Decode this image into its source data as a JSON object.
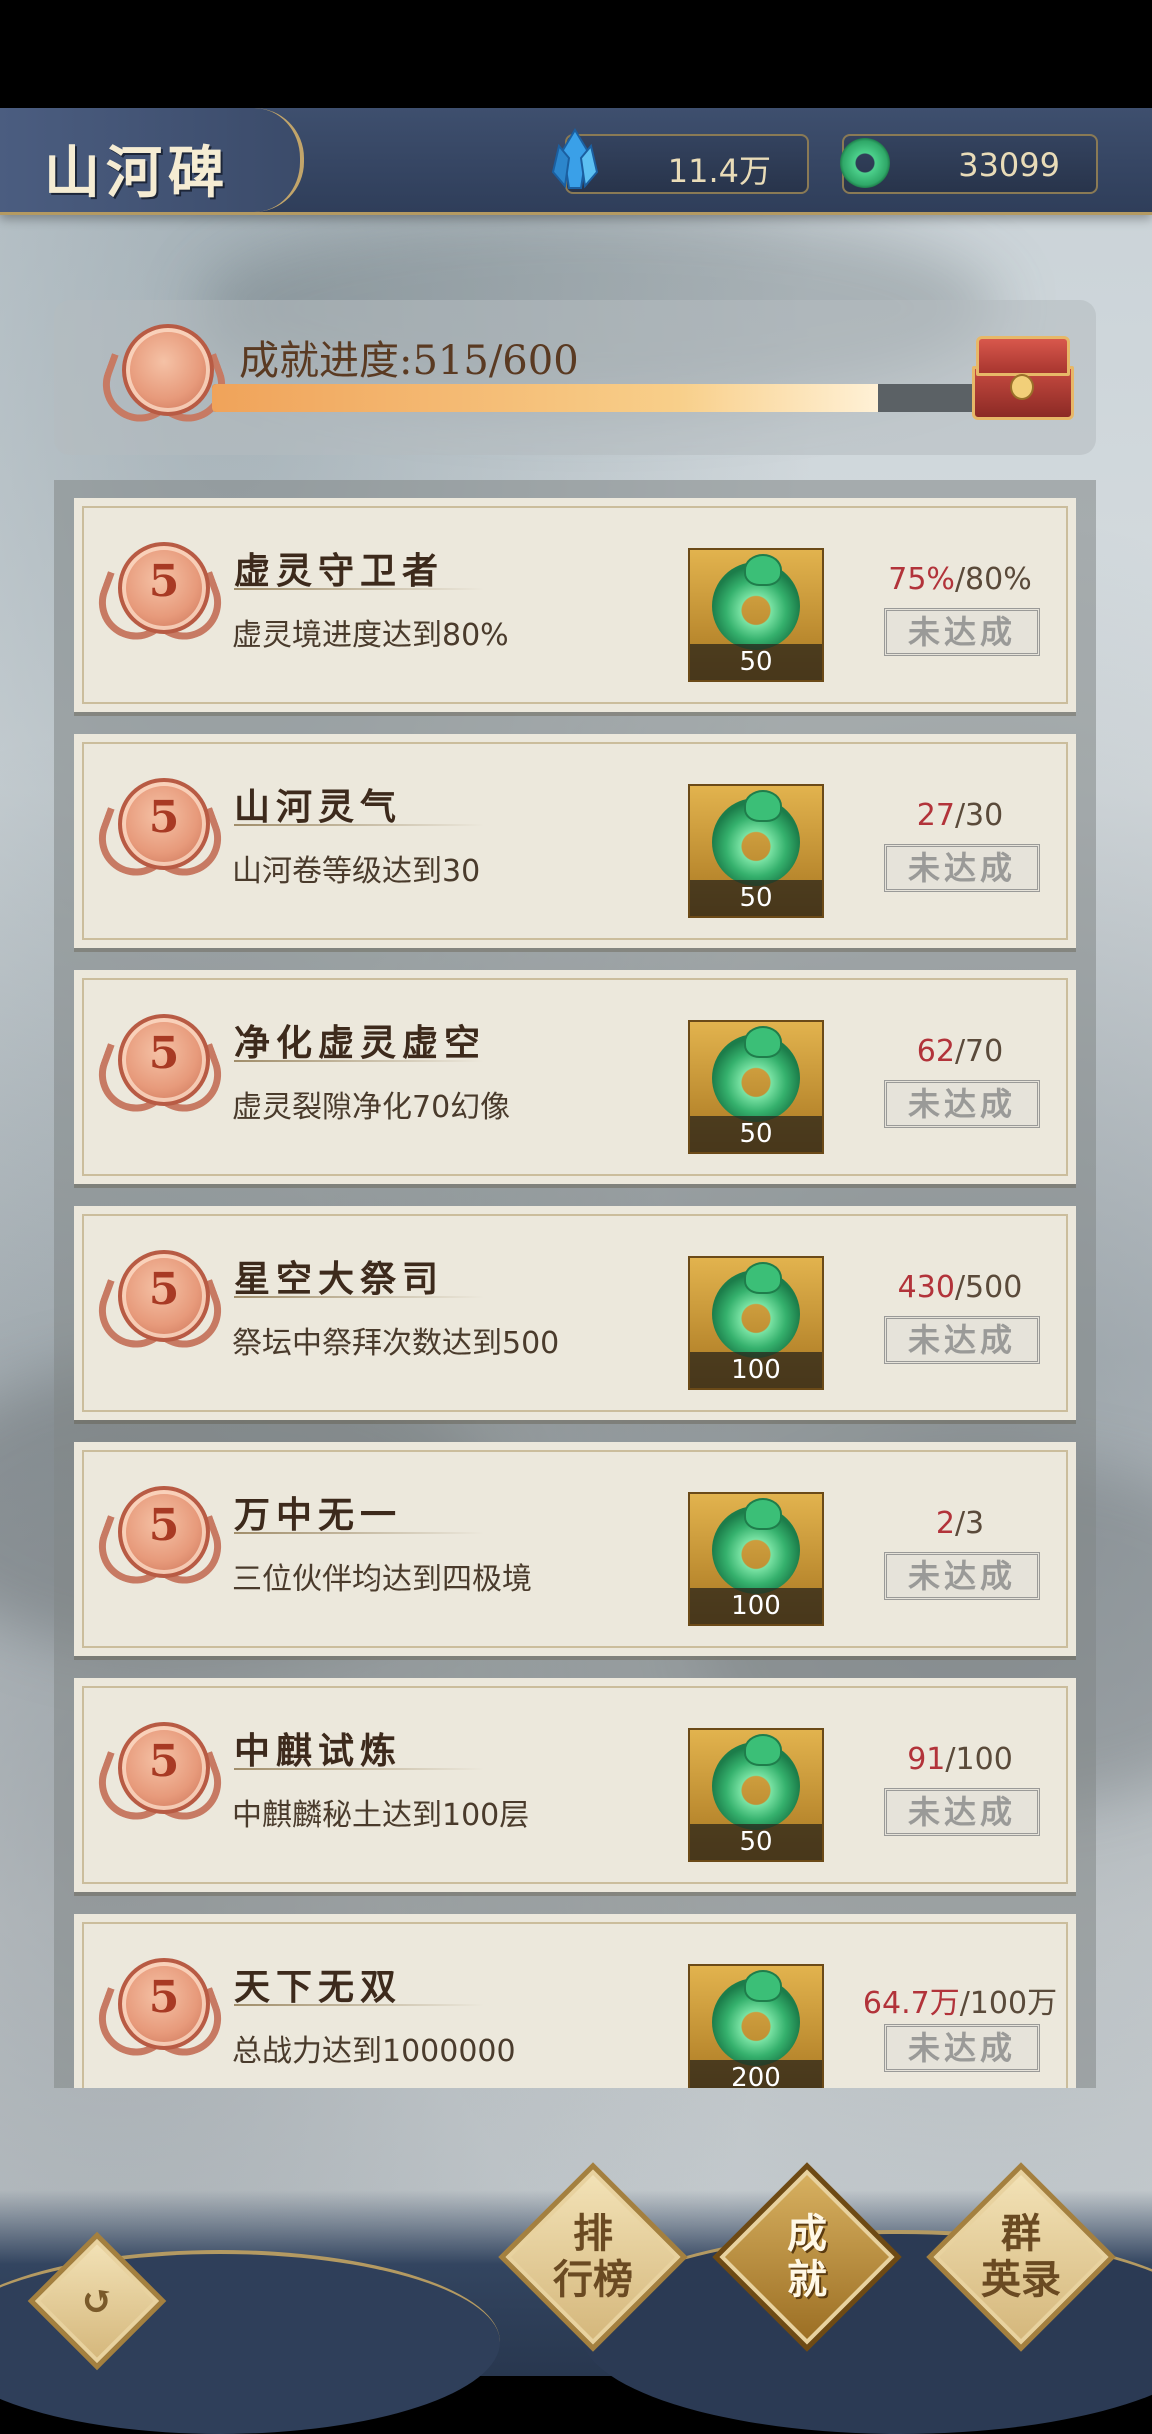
{
  "header": {
    "title": "山河碑",
    "gems": "11.4万",
    "jade": "33099"
  },
  "summary": {
    "label": "成就进度:515/600",
    "current": 515,
    "total": 600,
    "medal_level": "5"
  },
  "achievements": [
    {
      "level": "5",
      "name": "虚灵守卫者",
      "desc": "虚灵境进度达到80%",
      "reward": "50",
      "current": "75%",
      "target": "/80%",
      "status": "未达成"
    },
    {
      "level": "5",
      "name": "山河灵气",
      "desc": "山河卷等级达到30",
      "reward": "50",
      "current": "27",
      "target": "/30",
      "status": "未达成"
    },
    {
      "level": "5",
      "name": "净化虚灵虚空",
      "desc": "虚灵裂隙净化70幻像",
      "reward": "50",
      "current": "62",
      "target": "/70",
      "status": "未达成"
    },
    {
      "level": "5",
      "name": "星空大祭司",
      "desc": "祭坛中祭拜次数达到500",
      "reward": "100",
      "current": "430",
      "target": "/500",
      "status": "未达成"
    },
    {
      "level": "5",
      "name": "万中无一",
      "desc": "三位伙伴均达到四极境",
      "reward": "100",
      "current": "2",
      "target": "/3",
      "status": "未达成"
    },
    {
      "level": "5",
      "name": "中麒试炼",
      "desc": "中麒麟秘土达到100层",
      "reward": "50",
      "current": "91",
      "target": "/100",
      "status": "未达成"
    },
    {
      "level": "5",
      "name": "天下无双",
      "desc": "总战力达到1000000",
      "reward": "200",
      "current": "64.7万",
      "target": "/100万",
      "status": "未达成"
    }
  ],
  "nav": {
    "ranking_1": "排",
    "ranking_2": "行榜",
    "achieve_1": "成",
    "achieve_2": "就",
    "heroes_1": "群",
    "heroes_2": "英录"
  },
  "colors": {
    "header_bg": "#3e4f6e",
    "progress_current": "#b2333a",
    "bar_fill": "#f8cf8a"
  }
}
